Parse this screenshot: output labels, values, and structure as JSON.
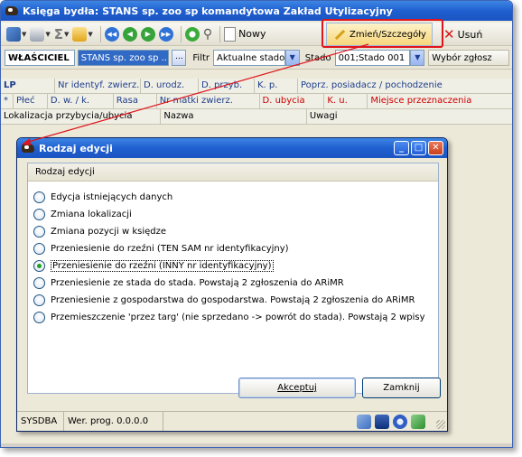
{
  "window": {
    "title": "Księga bydła: STANS sp. zoo sp komandytowa Zakład Utylizacyjny"
  },
  "toolbar": {
    "new_label": "Nowy",
    "edit_label": "Zmień/Szczegóły",
    "delete_label": "Usuń"
  },
  "filter": {
    "owner_label": "WŁAŚCICIEL",
    "owner_value": "STANS sp. zoo sp ...",
    "owner_button": "...",
    "filter_label": "Filtr",
    "filter_value": "Aktualne stado",
    "herd_label": "Stado",
    "herd_value": "001;Stado 001",
    "notification_select": "Wybór zgłosz"
  },
  "grid": {
    "row1": [
      "LP",
      "Nr identyf. zwierz.",
      "D. urodz.",
      "D. przyb.",
      "K. p.",
      "Poprz. posiadacz / pochodzenie"
    ],
    "row2_marker": "*",
    "row2": [
      "Płeć",
      "D. w. / k.",
      "Rasa",
      "Nr matki zwierz.",
      "D. ubycia",
      "K. u.",
      "Miejsce przeznaczenia"
    ],
    "row3": [
      "Lokalizacja przybycia/ubycia",
      "Nazwa",
      "Uwagi"
    ]
  },
  "dialog": {
    "title": "Rodzaj edycji",
    "panel_title": "Rodzaj edycji",
    "options": [
      "Edycja istniejących danych",
      "Zmiana lokalizacji",
      "Zmiana pozycji w księdze",
      "Przeniesienie do rzeźni (TEN SAM nr identyfikacyjny)",
      "Przeniesienie do rzeźni (INNY nr identyfikacyjny)",
      "Przeniesienie ze stada do stada. Powstają 2 zgłoszenia do ARiMR",
      "Przeniesienie z gospodarstwa do gospodarstwa. Powstają 2 zgłoszenia do ARiMR",
      "Przemieszczenie 'przez targ' (nie sprzedano -> powrót do stada). Powstają 2 wpisy"
    ],
    "selected_index": 4,
    "accept_label": "Akceptuj",
    "cancel_label": "Zamknij",
    "status_user": "SYSDBA",
    "status_version": "Wer. prog. 0.0.0.0"
  },
  "colors": {
    "title_blue": "#1f5fcf",
    "highlight_red": "#e0141c",
    "grid_header_blue": "#1d3e8a",
    "grid_red": "#cc0000",
    "radio_selected": "#21a121"
  }
}
